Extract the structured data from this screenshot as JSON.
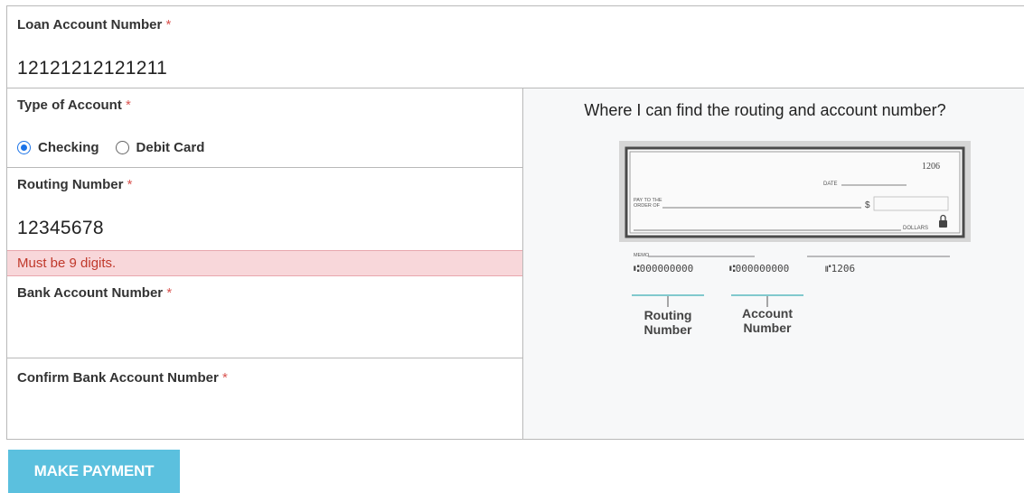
{
  "loan_account": {
    "label": "Loan Account Number",
    "required_mark": "*",
    "value": "12121212121211"
  },
  "account_type": {
    "label": "Type of Account",
    "required_mark": "*",
    "options": [
      {
        "label": "Checking",
        "selected": true
      },
      {
        "label": "Debit Card",
        "selected": false
      }
    ]
  },
  "routing_number": {
    "label": "Routing Number",
    "required_mark": "*",
    "value": "12345678",
    "error": "Must be 9 digits."
  },
  "bank_account": {
    "label": "Bank Account Number",
    "required_mark": "*",
    "value": ""
  },
  "confirm_bank_account": {
    "label": "Confirm Bank Account Number",
    "required_mark": "*",
    "value": ""
  },
  "help": {
    "title": "Where I can find the routing and account number?",
    "check": {
      "check_number": "1206",
      "date_label": "DATE",
      "pay_to_line1": "PAY TO THE",
      "pay_to_line2": "ORDER OF",
      "dollar_sign": "$",
      "dollars_label": "DOLLARS",
      "memo_label": "MEMO",
      "micr_routing": "⑆000000000",
      "micr_account": "⑆000000000",
      "micr_check": "⑈1206",
      "routing_caption_line1": "Routing",
      "routing_caption_line2": "Number",
      "account_caption_line1": "Account",
      "account_caption_line2": "Number"
    }
  },
  "submit_button": {
    "label": "MAKE PAYMENT"
  },
  "colors": {
    "accent": "#5bc0de",
    "radio": "#1a73e8",
    "error_bg": "#f8d7da",
    "error_text": "#c0392b",
    "required": "#d9534f",
    "callout": "#5ab9c0"
  }
}
